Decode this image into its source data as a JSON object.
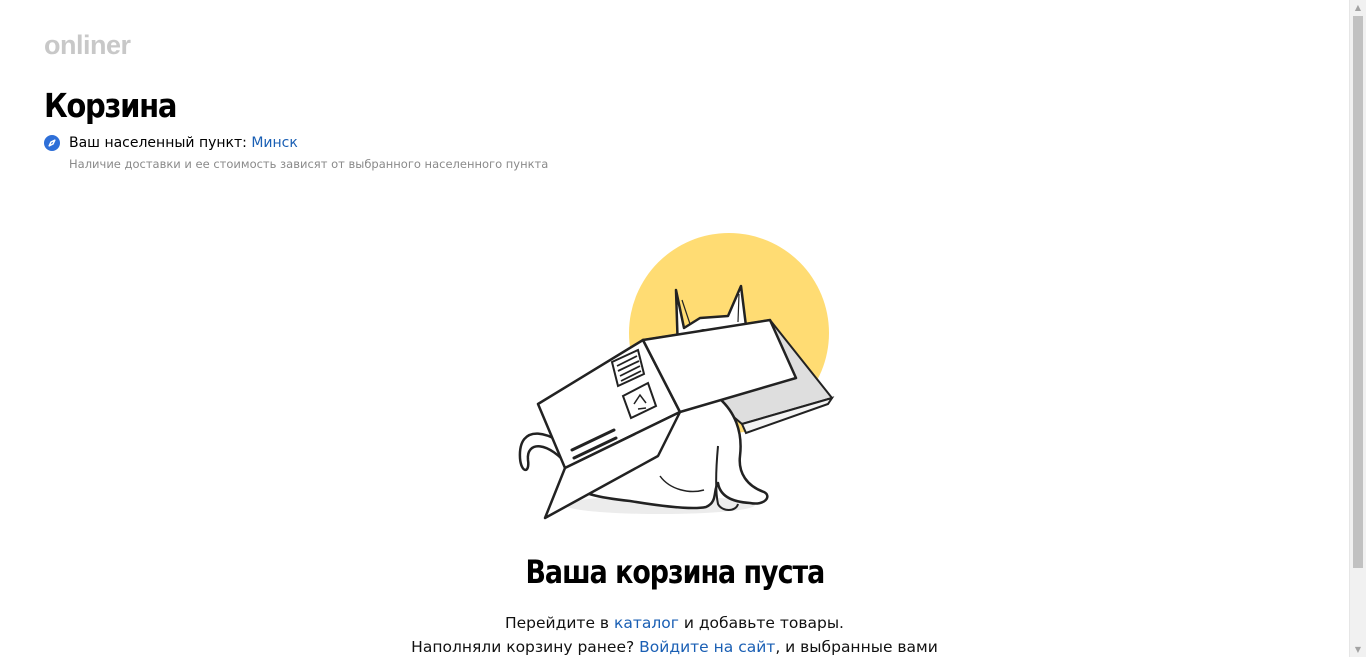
{
  "header": {
    "logo_text": "onliner"
  },
  "page": {
    "title": "Корзина"
  },
  "location": {
    "icon": "compass-icon",
    "label": "Ваш населенный пункт: ",
    "city": "Минск",
    "hint": "Наличие доставки и ее стоимость зависят от выбранного населенного пункта"
  },
  "empty_cart": {
    "illustration": "cat-in-box-illustration",
    "title": "Ваша корзина пуста",
    "line1_before": "Перейдите в ",
    "catalog_link": "каталог",
    "line1_after": " и добавьте товары.",
    "line2_before": "Наполняли корзину ранее? ",
    "login_link": "Войдите на сайт",
    "line2_after": ", и выбранные вами"
  },
  "colors": {
    "link": "#1a5fb4",
    "accent_circle": "#ffdc73",
    "logo": "#c8c8c8",
    "location_icon": "#2e6fd8"
  }
}
